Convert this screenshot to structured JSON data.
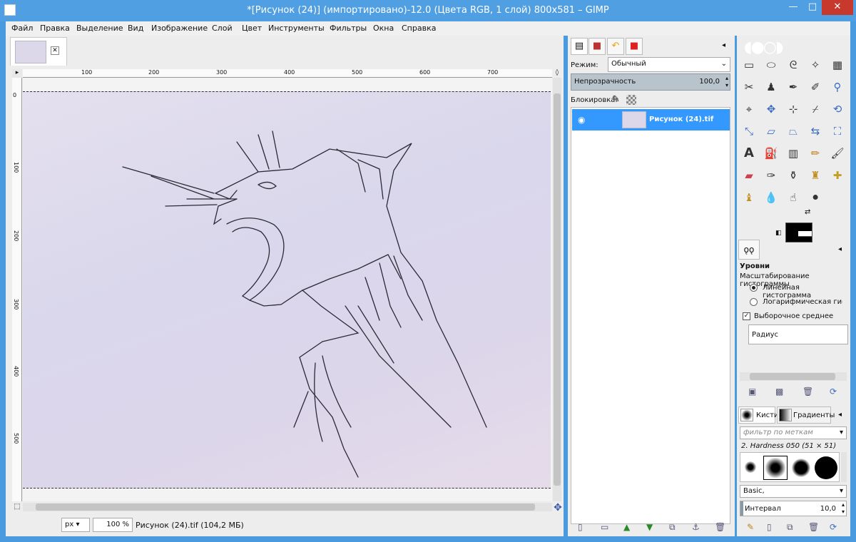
{
  "window": {
    "title": "*[Рисунок (24)] (импортировано)-12.0 (Цвета RGB, 1 слой) 800x581 – GIMP",
    "minimize": "—",
    "maximize": "□",
    "close": "✕"
  },
  "menu": [
    "Файл",
    "Правка",
    "Выделение",
    "Вид",
    "Изображение",
    "Слой",
    "Цвет",
    "Инструменты",
    "Фильтры",
    "Окна",
    "Справка"
  ],
  "image": {
    "tab_close": "✕",
    "hruler": [
      "100",
      "200",
      "300",
      "400",
      "500",
      "600",
      "700"
    ],
    "vruler": [
      "100",
      "200",
      "300",
      "400",
      "500"
    ],
    "vruler_zero": "0"
  },
  "status": {
    "unit": "px",
    "zoom": "100 %",
    "info": "Рисунок (24).tif (104,2 МБ)"
  },
  "layers": {
    "mode_label": "Режим:",
    "mode_value": "Обычный",
    "opacity_label": "Непрозрачность",
    "opacity_value": "100,0",
    "lock_label": "Блокировка:",
    "layer_name": "Рисунок (24).tif"
  },
  "levels": {
    "title": "Уровни",
    "subtitle": "Масштабирование гистограммы",
    "opt_linear": "Линейная гистограмма",
    "opt_log": "Логарифмическая гистогра",
    "sample_average": "Выборочное среднее",
    "radius": "Радиус"
  },
  "brushes": {
    "tab_brushes": "Кисти",
    "tab_gradients": "Градиенты",
    "filter_placeholder": "фильтр по меткам",
    "brush_name": "2. Hardness 050 (51 × 51)",
    "preset": "Basic,",
    "interval_label": "Интервал",
    "interval_value": "10,0"
  }
}
